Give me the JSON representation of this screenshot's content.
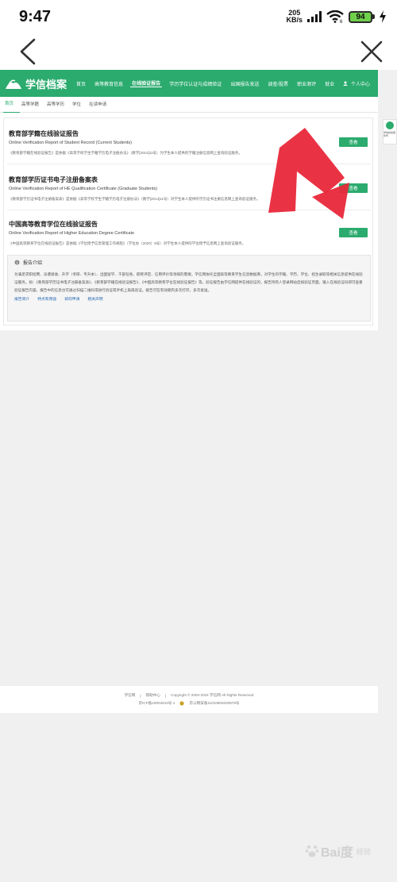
{
  "status_bar": {
    "time": "9:47",
    "speed_value": "205",
    "speed_unit": "KB/s",
    "battery": "94",
    "wifi_badge": "6"
  },
  "site": {
    "logo_text": "学信档案",
    "nav": [
      "首页",
      "高等教育信息",
      "在线验证报告",
      "学历学位认证与成绩验证",
      "出国报告发送",
      "调查/投票",
      "职业测评",
      "就业",
      "个人中心"
    ],
    "active_nav": "在线验证报告",
    "sub_nav": [
      "首页",
      "高等学籍",
      "高等学历",
      "学位",
      "在读申请"
    ],
    "active_sub_nav": "首页"
  },
  "reports": [
    {
      "title": "教育部学籍在线验证报告",
      "subtitle": "Online Verification Report of Student Record (Current Students)",
      "desc": "《教育部学籍在线验证报告》是依据《高等学校学生学籍学历电子注册办法》（教学[2014]11号）为学生本人提供的学籍注册信息网上查询验证服务。",
      "button": "查看"
    },
    {
      "title": "教育部学历证书电子注册备案表",
      "subtitle": "Online Verification Report of HE Qualification Certificate (Graduate Students)",
      "desc": "《教育部学历证书电子注册备案表》是依据《高等学校学生学籍学历电子注册办法》（教学[2014]11号）对学生本人提供的学历证书注册信息网上查询验证服务。",
      "button": "查看"
    },
    {
      "title": "中国高等教育学位在线验证报告",
      "subtitle": "Online Verification Report of Higher Education Degree Certificate",
      "desc": "《中国高等教育学位在线验证报告》是依据《学位授予信息管理工作规程》（学位办〔2020〕8号）对学生本人提供的学位授予信息网上查询验证服务。",
      "button": "查看"
    }
  ],
  "intro": {
    "heading": "报告介绍",
    "text": "为满足求职招聘、派遣接收、升学（考研、专升本）、出国留学、干部任免、职称评定、信用评价等领域的需要，学信网依托全国高等教育学生信息数据库，对学生的学籍、学历、学位、招生录取等相关信息提供在线验证服务。如：《教育部学历证书电子注册备案表》、《教育部学籍在线验证报告》、《中国高等教育学位在线验证报告》等。验证报告由学信网提供在线验证的，报告持有人登录网站后按验证页面，输入在线验证码即可查看验证报告内容。报告中的信息也可通过扫描二维码或进行验证或手机上再再验证。报告可在有效期内多次打印，多次发送。",
    "links": [
      "报告简介",
      "特点和用途",
      "如何申请",
      "相关声明"
    ]
  },
  "side_widget": "学信档案服务号",
  "footer": {
    "links": [
      "学信网",
      "帮助中心"
    ],
    "copyright": "Copyright © 2003-2024 学信网 All Rights Reserved",
    "icp": "京ICP备19004913号-1",
    "police": "京公网安备11010802020878号"
  },
  "watermark": {
    "brand": "Bai度",
    "sub": "经验"
  },
  "colors": {
    "brand_green": "#2bab6e",
    "arrow_red": "#e8283a"
  }
}
